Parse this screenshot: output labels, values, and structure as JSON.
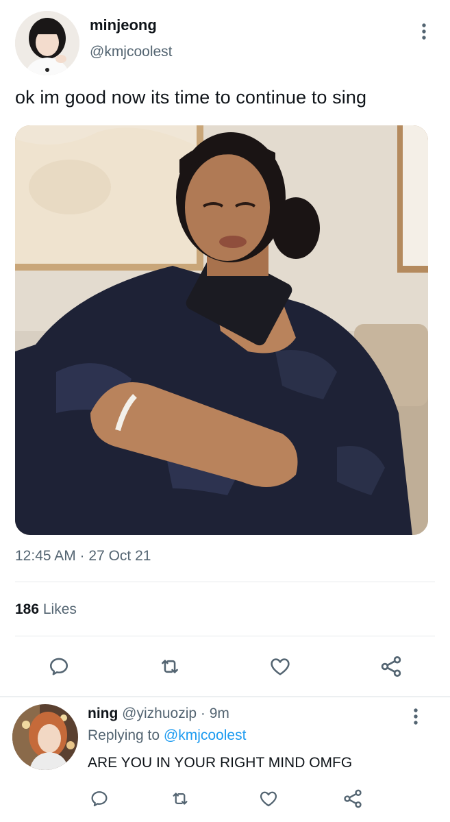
{
  "tweet": {
    "display_name": "minjeong",
    "handle": "@kmjcoolest",
    "text": "ok im good now its time to continue to sing",
    "timestamp": "12:45 AM · 27 Oct 21",
    "likes_count": "186",
    "likes_label": " Likes",
    "icons": {
      "more": "more-vertical-icon",
      "reply": "reply-icon",
      "retweet": "retweet-icon",
      "like": "heart-icon",
      "share": "share-icon"
    }
  },
  "reply": {
    "display_name": "ning",
    "handle": "@yizhuozip",
    "time": " · 9m",
    "replying_prefix": "Replying to ",
    "replying_to": "@kmjcoolest",
    "text": "ARE YOU IN YOUR RIGHT MIND OMFG"
  },
  "colors": {
    "text_primary": "#0f1419",
    "text_secondary": "#536471",
    "accent": "#1d9bf0",
    "divider": "#e6e9ec"
  }
}
